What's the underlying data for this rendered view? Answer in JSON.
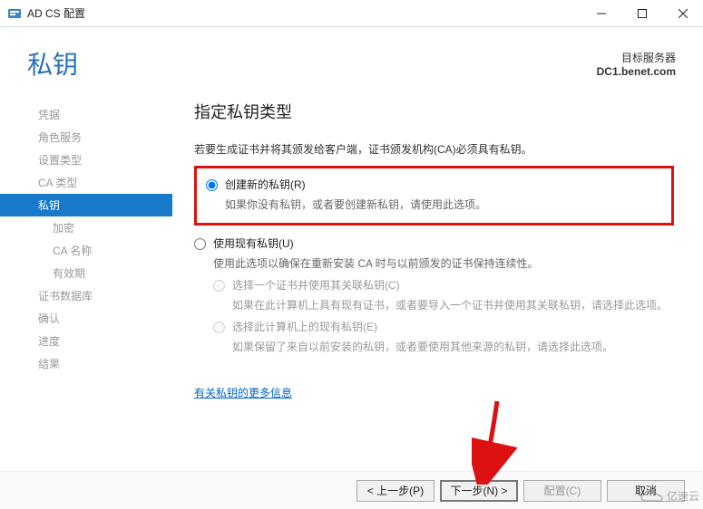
{
  "window": {
    "title": "AD CS 配置",
    "icon_name": "server-config-icon"
  },
  "header": {
    "title": "私钥",
    "target_label": "目标服务器",
    "target_server": "DC1.benet.com"
  },
  "sidebar": {
    "items": [
      {
        "label": "凭据",
        "state": "done"
      },
      {
        "label": "角色服务",
        "state": "done"
      },
      {
        "label": "设置类型",
        "state": "done"
      },
      {
        "label": "CA 类型",
        "state": "done"
      },
      {
        "label": "私钥",
        "state": "active"
      },
      {
        "label": "加密",
        "state": "sub"
      },
      {
        "label": "CA 名称",
        "state": "sub"
      },
      {
        "label": "有效期",
        "state": "sub"
      },
      {
        "label": "证书数据库",
        "state": "pending"
      },
      {
        "label": "确认",
        "state": "pending"
      },
      {
        "label": "进度",
        "state": "pending"
      },
      {
        "label": "结果",
        "state": "pending"
      }
    ]
  },
  "content": {
    "heading": "指定私钥类型",
    "intro": "若要生成证书并将其颁发给客户端，证书颁发机构(CA)必须具有私钥。",
    "opt_create": {
      "label": "创建新的私钥(R)",
      "desc": "如果你没有私钥，或者要创建新私钥，请使用此选项。",
      "checked": true
    },
    "opt_existing": {
      "label": "使用现有私钥(U)",
      "desc": "使用此选项以确保在重新安装 CA 时与以前颁发的证书保持连续性。",
      "sub1": {
        "label": "选择一个证书并使用其关联私钥(C)",
        "desc": "如果在此计算机上具有现有证书，或者要导入一个证书并使用其关联私钥，请选择此选项。"
      },
      "sub2": {
        "label": "选择此计算机上的现有私钥(E)",
        "desc": "如果保留了来自以前安装的私钥，或者要使用其他来源的私钥，请选择此选项。"
      }
    },
    "more_link": "有关私钥的更多信息"
  },
  "footer": {
    "prev": "< 上一步(P)",
    "next": "下一步(N) >",
    "configure": "配置(C)",
    "cancel": "取消"
  },
  "watermark": {
    "text": "亿速云"
  }
}
